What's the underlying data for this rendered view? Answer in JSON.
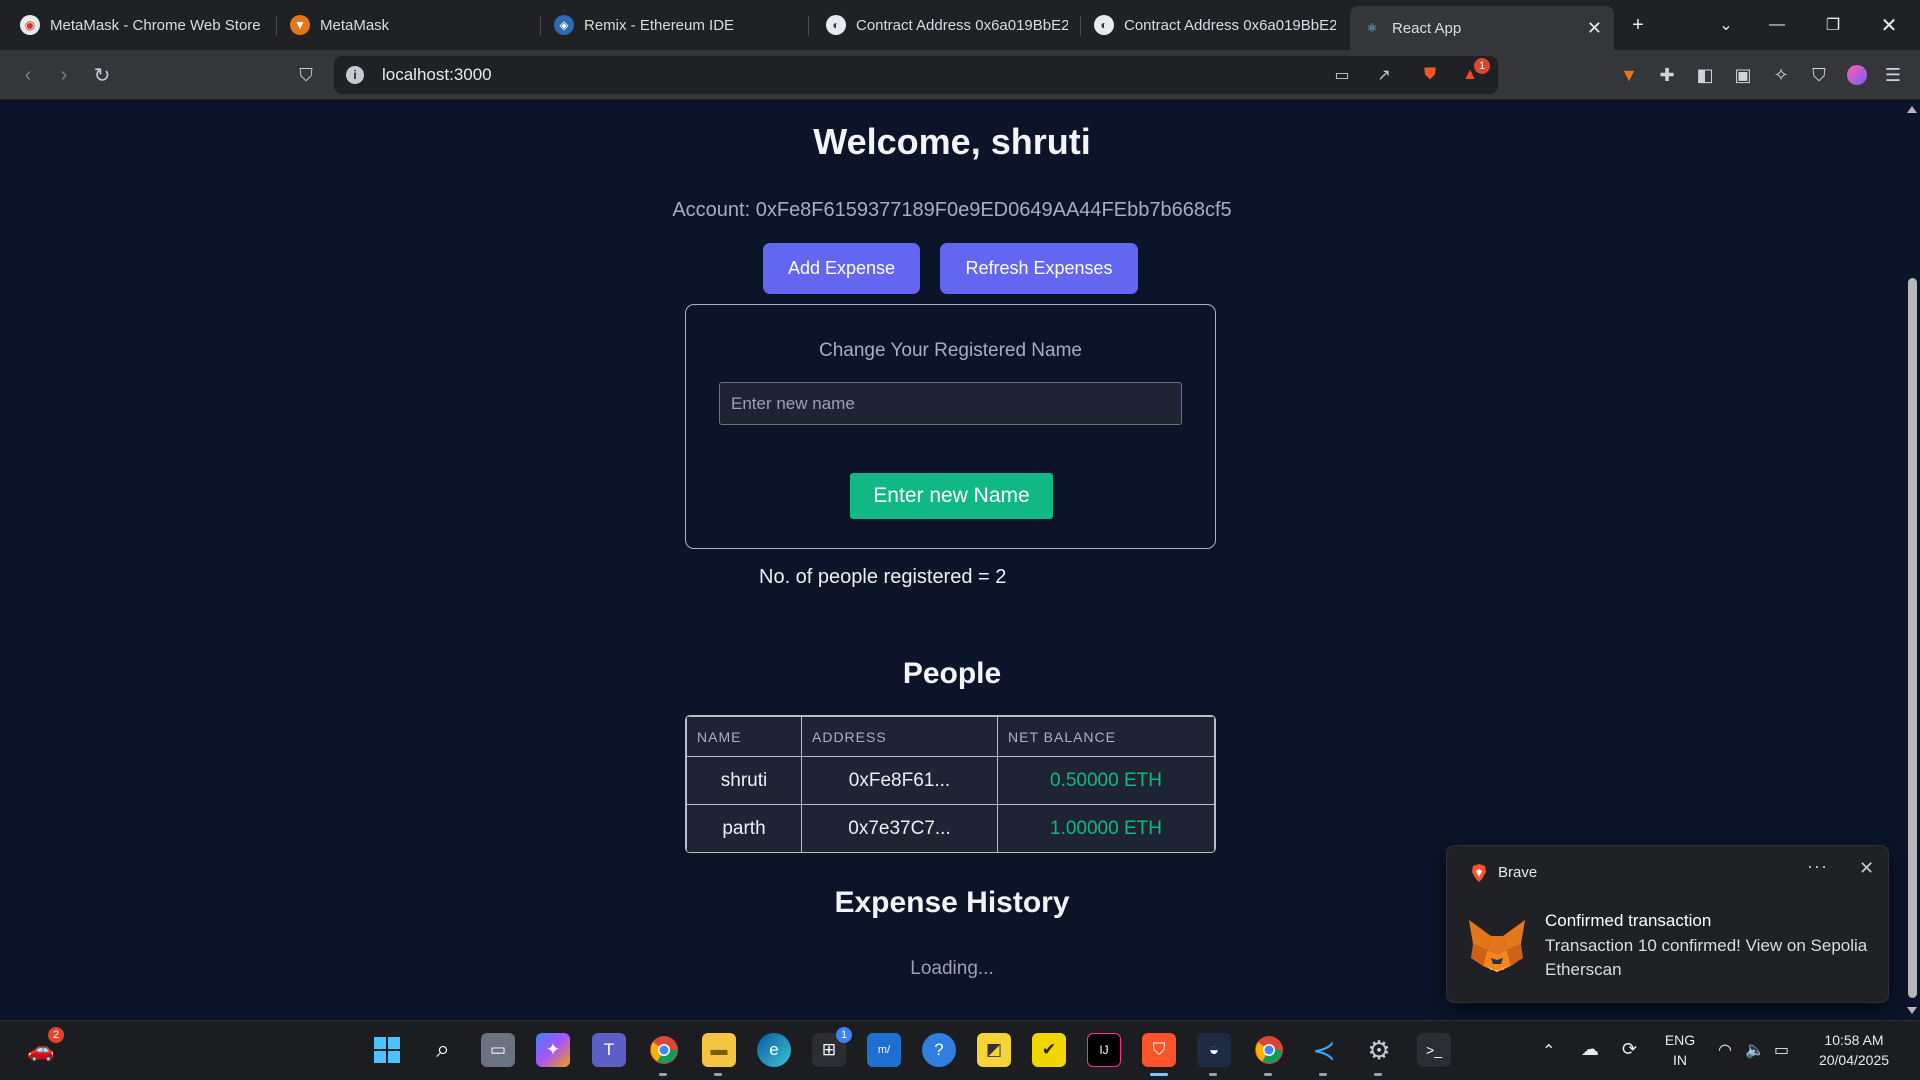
{
  "browser": {
    "tabs": [
      {
        "title": "MetaMask - Chrome Web Store",
        "icon": "chrome-web-store-icon"
      },
      {
        "title": "MetaMask",
        "icon": "metamask-fox-icon"
      },
      {
        "title": "Remix - Ethereum IDE",
        "icon": "remix-icon"
      },
      {
        "title": "Contract Address 0x6a019BbE2",
        "icon": "etherscan-icon"
      },
      {
        "title": "Contract Address 0x6a019BbE2",
        "icon": "etherscan-icon"
      },
      {
        "title": "React App",
        "icon": "react-icon",
        "active": true
      }
    ],
    "url": "localhost:3000",
    "rewards_badge": "1"
  },
  "app": {
    "welcome": "Welcome, shruti",
    "account": "Account: 0xFe8F6159377189F0e9ED0649AA44FEbb7b668cf5",
    "add_expense_label": "Add Expense",
    "refresh_expenses_label": "Refresh Expenses",
    "change_name": {
      "title": "Change Your Registered Name",
      "input_placeholder": "Enter new name",
      "input_value": "",
      "submit_label": "Enter new Name"
    },
    "registered_count_text": "No. of people registered = 2",
    "people_title": "People",
    "people_table": {
      "headers": [
        "NAME",
        "ADDRESS",
        "NET BALANCE"
      ],
      "rows": [
        {
          "name": "shruti",
          "address": "0xFe8F61...",
          "balance": "0.50000 ETH"
        },
        {
          "name": "parth",
          "address": "0x7e37C7...",
          "balance": "1.00000 ETH"
        }
      ]
    },
    "expense_history_title": "Expense History",
    "expense_history_status": "Loading...",
    "colors": {
      "primary": "#6366f1",
      "success": "#10b981",
      "background": "#0b1428"
    }
  },
  "notification": {
    "app": "Brave",
    "title": "Confirmed transaction",
    "body": "Transaction 10 confirmed! View on Sepolia Etherscan"
  },
  "taskbar": {
    "widgets_badge": "2",
    "store_badge": "1",
    "language": "ENG",
    "region": "IN",
    "time": "10:58 AM",
    "date": "20/04/2025"
  }
}
